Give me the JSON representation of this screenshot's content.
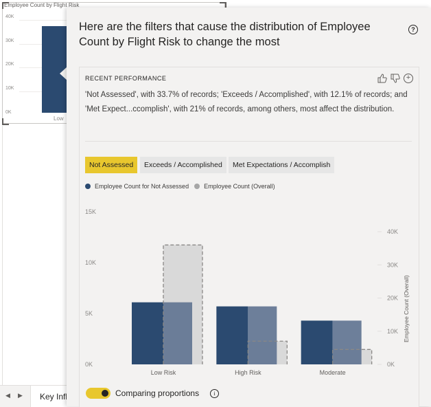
{
  "background_visual": {
    "title": "Employee Count by Flight Risk",
    "y_ticks": [
      "40K",
      "30K",
      "20K",
      "10K",
      "0K"
    ],
    "category_label": "Low"
  },
  "page_tabs": {
    "prev_icon": "triangle-left-icon",
    "next_icon": "triangle-right-icon",
    "active_tab": "Key Influ"
  },
  "popup": {
    "title": "Here are the filters that cause the distribution of Employee Count by Flight Risk to change the most",
    "help_icon": "?",
    "card": {
      "heading": "RECENT PERFORMANCE",
      "description": "'Not Assessed', with 33.7% of records; 'Exceeds / Accomplished', with 12.1% of records; and 'Met Expect...ccomplish', with 21% of records, among others, most affect the distribution.",
      "icons": [
        "thumbs-up-icon",
        "thumbs-down-icon",
        "plus-circle-icon"
      ],
      "filters": [
        {
          "label": "Not Assessed",
          "active": true
        },
        {
          "label": "Exceeds / Accomplished",
          "active": false
        },
        {
          "label": "Met Expectations / Accomplish",
          "active": false
        }
      ],
      "legend": [
        {
          "label": "Employee Count for Not Assessed",
          "color": "#2b4a70"
        },
        {
          "label": "Employee Count (Overall)",
          "color": "#a6a6a6"
        }
      ],
      "toggle_label": "Comparing proportions",
      "toggle_on": true
    }
  },
  "chart_data": {
    "type": "bar",
    "categories": [
      "Low Risk",
      "High Risk",
      "Moderate"
    ],
    "series": [
      {
        "name": "Employee Count for Not Assessed",
        "axis": "left",
        "values": [
          6100,
          5700,
          4300
        ],
        "color": "#2b4a70"
      },
      {
        "name": "Employee Count (Overall)",
        "axis": "right",
        "values": [
          36000,
          7000,
          4500
        ],
        "color": "#d9d9d9"
      }
    ],
    "left_axis": {
      "ticks": [
        "15K",
        "10K",
        "5K",
        "0K"
      ],
      "range": [
        0,
        15000
      ]
    },
    "right_axis": {
      "label": "Employee Count (Overall)",
      "ticks": [
        "40K",
        "30K",
        "20K",
        "10K",
        "0K"
      ],
      "range": [
        0,
        40000
      ]
    }
  }
}
